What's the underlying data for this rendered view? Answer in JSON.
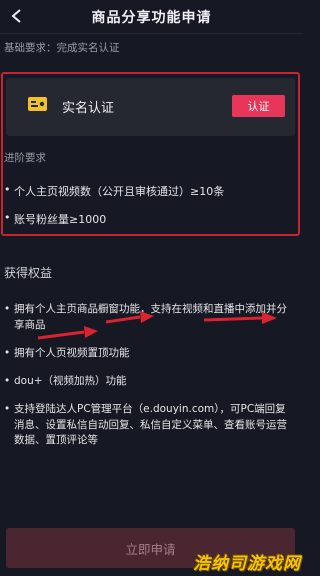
{
  "header": {
    "title": "商品分享功能申请"
  },
  "basic_requirement": "基础要求：完成实名认证",
  "verification_card": {
    "icon": "id-card-icon",
    "label": "实名认证",
    "button_label": "认证"
  },
  "advanced": {
    "label": "进阶要求",
    "items": [
      "个人主页视频数（公开且审核通过）≥10条",
      "账号粉丝量≥1000"
    ]
  },
  "benefits": {
    "title": "获得权益",
    "items": [
      "拥有个人主页商品橱窗功能，支持在视频和直播中添加并分享商品",
      "拥有个人页视频置顶功能",
      "dou+（视频加热）功能",
      "支持登陆达人PC管理平台（e.douyin.com），可PC端回复消息、设置私信自动回复、私信自定义菜单、查看账号运营数据、置顶评论等"
    ]
  },
  "apply_button_label": "立即申请",
  "watermark": "浩纳司游戏网",
  "colors": {
    "background": "#161823",
    "accent": "#e8365a",
    "highlight_border": "#c62433"
  }
}
